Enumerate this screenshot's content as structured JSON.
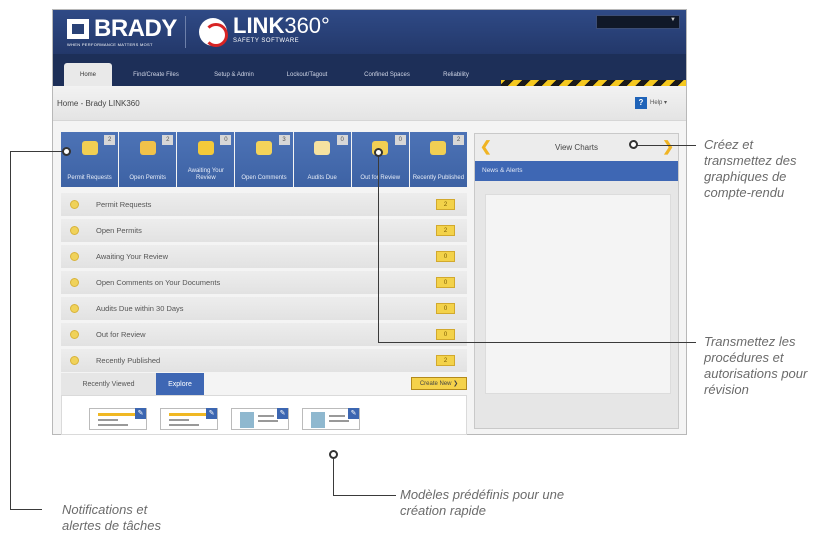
{
  "brand": {
    "brady_name": "BRADY",
    "brady_tagline": "WHEN PERFORMANCE MATTERS MOST",
    "link_name_bold": "LINK",
    "link_name_thin": "360°",
    "link_sub": "SAFETY SOFTWARE"
  },
  "nav": {
    "tabs": [
      {
        "label": "Home",
        "active": true
      },
      {
        "label": "Find/Create Files"
      },
      {
        "label": "Setup & Admin"
      },
      {
        "label": "Lockout/Tagout"
      },
      {
        "label": "Confined Spaces"
      },
      {
        "label": "Reliability"
      }
    ]
  },
  "breadcrumb": "Home - Brady LINK360",
  "help": {
    "icon": "?",
    "label": "Help ▾"
  },
  "tiles": [
    {
      "label": "Permit Requests",
      "count": "2",
      "icon": "upload-icon",
      "color": "#f1cf53"
    },
    {
      "label": "Open Permits",
      "count": "2",
      "icon": "stack-icon",
      "color": "#f1c24a"
    },
    {
      "label": "Awaiting Your Review",
      "count": "0",
      "icon": "star-icon",
      "color": "#f3c93a"
    },
    {
      "label": "Open Comments",
      "count": "3",
      "icon": "comment-icon",
      "color": "#f3d35a"
    },
    {
      "label": "Audits Due",
      "count": "0",
      "icon": "calendar-icon",
      "color": "#f6e2a0"
    },
    {
      "label": "Out for Review",
      "count": "0",
      "icon": "people-icon",
      "color": "#f1cf53"
    },
    {
      "label": "Recently Published",
      "count": "2",
      "icon": "document-icon",
      "color": "#f1cf53"
    }
  ],
  "notifications": [
    {
      "label": "Permit Requests",
      "count": "2"
    },
    {
      "label": "Open Permits",
      "count": "2"
    },
    {
      "label": "Awaiting Your Review",
      "count": "0"
    },
    {
      "label": "Open Comments on Your Documents",
      "count": "0"
    },
    {
      "label": "Audits Due within 30 Days",
      "count": "0"
    },
    {
      "label": "Out for Review",
      "count": "0"
    },
    {
      "label": "Recently Published",
      "count": "2"
    }
  ],
  "bottom_tabs": {
    "recently_viewed": "Recently Viewed",
    "explore": "Explore",
    "create_new": "Create New ❯"
  },
  "right_panel": {
    "charts_title": "View Charts",
    "news_title": "News & Alerts"
  },
  "callouts": {
    "charts": "Créez et transmettez des graphiques de compte-rendu",
    "review": "Transmettez les procédures et autorisations pour révision",
    "templates": "Modèles prédéfinis pour une création rapide",
    "notifications": "Notifications et alertes de tâches"
  }
}
